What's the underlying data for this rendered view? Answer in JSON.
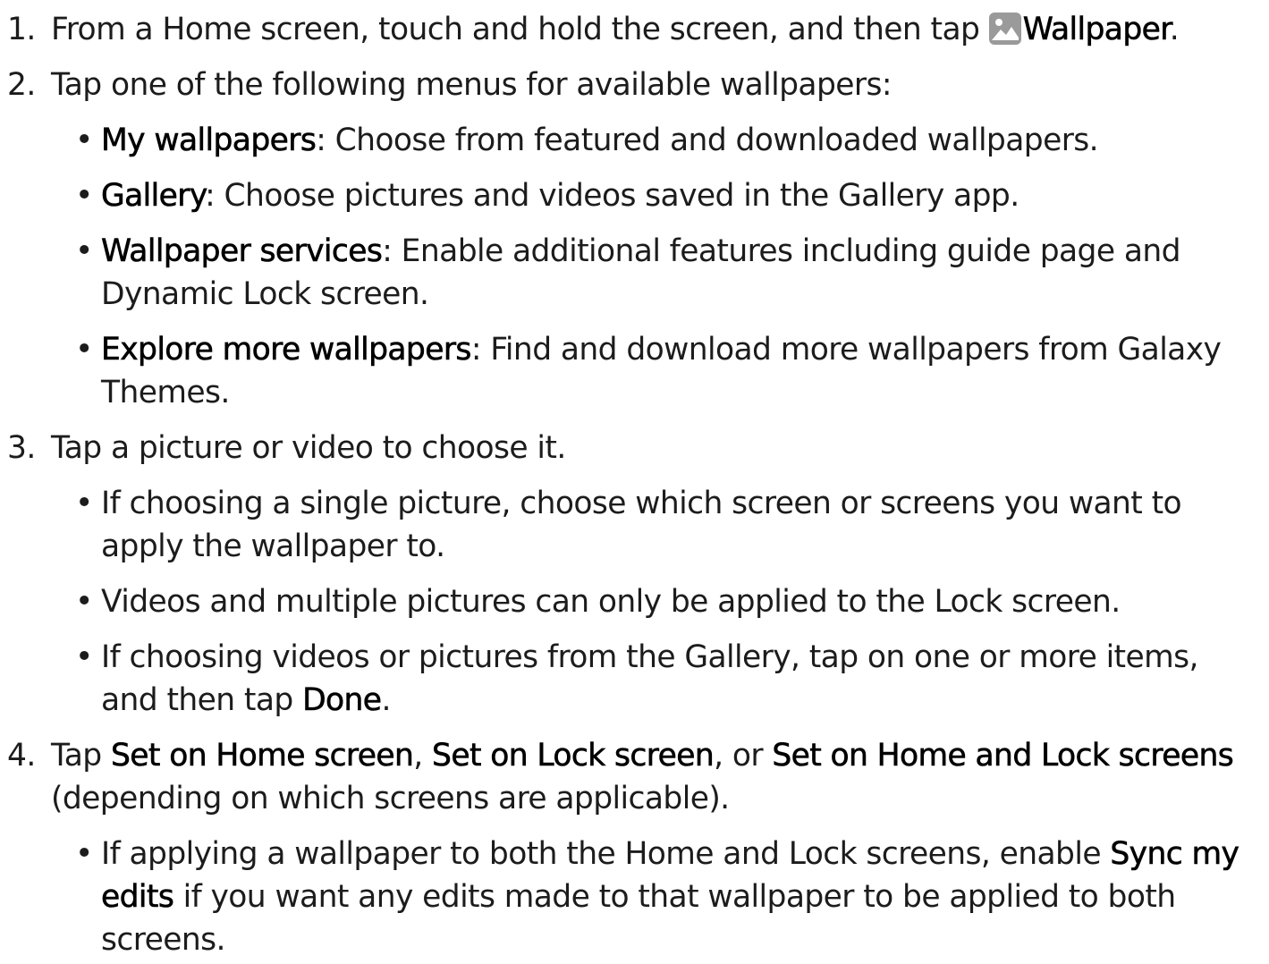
{
  "steps": [
    {
      "num": "1.",
      "text_before": "From a Home screen, touch and hold the screen, and then tap ",
      "icon": "wallpaper-icon",
      "bold": "Wallpaper",
      "text_after": "."
    },
    {
      "num": "2.",
      "text": "Tap one of the following menus for available wallpapers:",
      "bullets": [
        {
          "bold": "My wallpapers",
          "text": ": Choose from featured and downloaded wallpapers."
        },
        {
          "bold": "Gallery",
          "text": ": Choose pictures and videos saved in the Gallery app."
        },
        {
          "bold": "Wallpaper services",
          "text": ": Enable additional features including guide page and Dynamic Lock screen."
        },
        {
          "bold": "Explore more wallpapers",
          "text": ": Find and download more wallpapers from Galaxy Themes."
        }
      ]
    },
    {
      "num": "3.",
      "text": "Tap a picture or video to choose it.",
      "bullets": [
        {
          "text": "If choosing a single picture, choose which screen or screens you want to apply the wallpaper to."
        },
        {
          "text": "Videos and multiple pictures can only be applied to the Lock screen."
        },
        {
          "text": "If choosing videos or pictures from the Gallery, tap on one or more items, and then tap ",
          "bold": "Done",
          "after": "."
        }
      ]
    },
    {
      "num": "4.",
      "t1": "Tap ",
      "b1": "Set on Home screen",
      "t2": ", ",
      "b2": "Set on Lock screen",
      "t3": ", or ",
      "b3": "Set on Home and Lock screens",
      "t4": " (depending on which screens are applicable).",
      "bullets": [
        {
          "text": "If applying a wallpaper to both the Home and Lock screens, enable ",
          "bold": "Sync my edits",
          "after": " if you want any edits made to that wallpaper to be applied to both screens."
        }
      ]
    }
  ],
  "bullet_char": "•",
  "colors": {
    "text": "#1c1c1c",
    "icon_bg": "#9a9a9a"
  }
}
